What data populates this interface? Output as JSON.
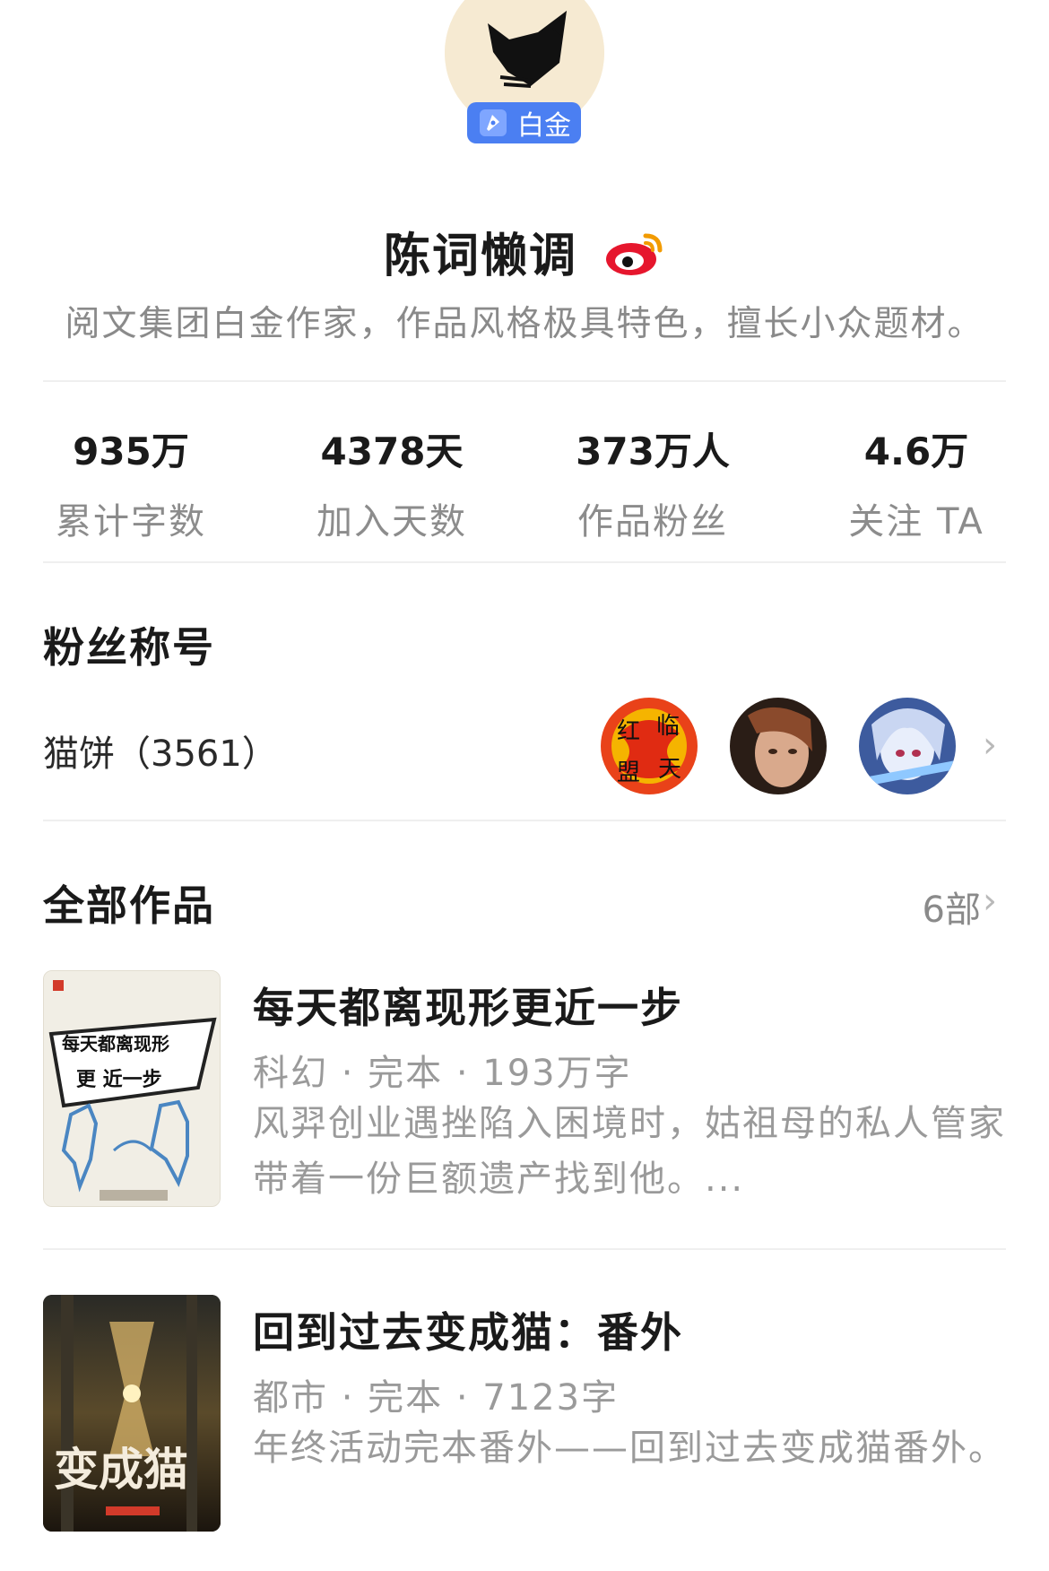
{
  "profile": {
    "badge_label": "白金",
    "name": "陈词懒调",
    "bio": "阅文集团白金作家，作品风格极具特色，擅长小众题材。",
    "weibo_icon": "weibo-icon",
    "accent": "#4b7ff2"
  },
  "stats": [
    {
      "value": "935万",
      "label": "累计字数"
    },
    {
      "value": "4378天",
      "label": "加入天数"
    },
    {
      "value": "373万人",
      "label": "作品粉丝"
    },
    {
      "value": "4.6万",
      "label": "关注 TA"
    }
  ],
  "fans": {
    "title": "粉丝称号",
    "label": "猫饼（3561）",
    "avatar_icons": [
      "fan-avatar-icon",
      "fan-avatar-icon",
      "fan-avatar-icon"
    ]
  },
  "works": {
    "title": "全部作品",
    "count": "6部",
    "books": [
      {
        "title": "每天都离现形更近一步",
        "meta": "科幻 · 完本 · 193万字",
        "desc": "风羿创业遇挫陷入困境时，姑祖母的私人管家带着一份巨额遗产找到他。...",
        "cover_text": "每天都离现形更近一步"
      },
      {
        "title": "回到过去变成猫：番外",
        "meta": "都市 · 完本 · 7123字",
        "desc": "年终活动完本番外——回到过去变成猫番外。",
        "cover_text": "变成猫"
      }
    ]
  }
}
